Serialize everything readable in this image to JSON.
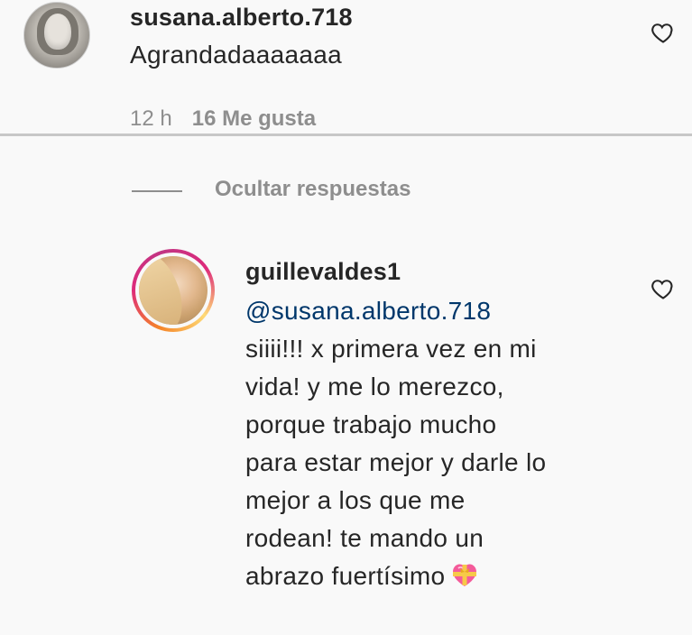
{
  "comments": [
    {
      "username": "susana.alberto.718",
      "text": "Agrandadaaaaaaa",
      "time": "12 h",
      "likes": "16 Me gusta"
    }
  ],
  "replies_toggle": {
    "label": "Ocultar respuestas"
  },
  "reply": {
    "username": "guillevaldes1",
    "mention": "@susana.alberto.718",
    "lines": [
      "siiii!!! x primera vez en mi",
      "vida! y me lo merezco,",
      "porque trabajo mucho",
      "para estar mejor y darle lo",
      "mejor a los que me",
      "rodean! te mando un",
      "abrazo fuertísimo"
    ],
    "emoji_icon": "heart-with-ribbon-emoji"
  },
  "colors": {
    "text": "#262626",
    "meta": "#8e8e8e",
    "mention": "#00376b",
    "background": "#f9f9f9",
    "divider": "#c7c7c7"
  }
}
